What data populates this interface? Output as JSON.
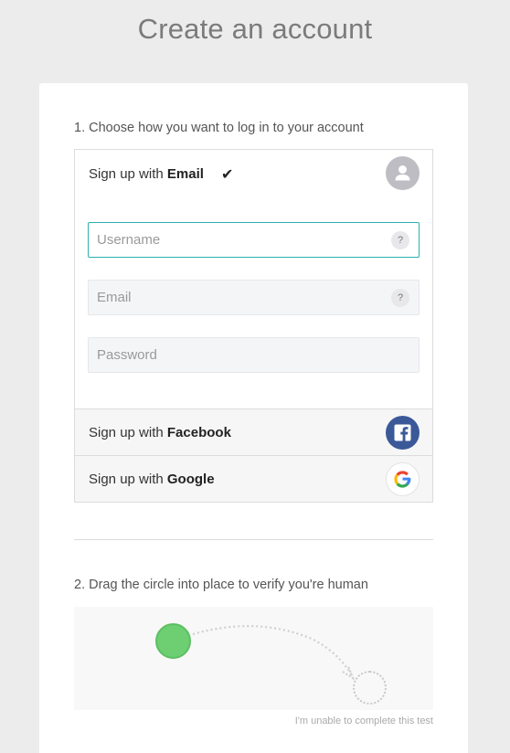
{
  "header": {
    "title": "Create an account"
  },
  "step1": {
    "label": "1. Choose how you want to log in to your account",
    "email_option": {
      "prefix": "Sign up with ",
      "method": "Email",
      "check_glyph": "✔",
      "icon": "person-icon"
    },
    "fields": {
      "username": {
        "placeholder": "Username",
        "value": "",
        "help": "?"
      },
      "email": {
        "placeholder": "Email",
        "value": "",
        "help": "?"
      },
      "password": {
        "placeholder": "Password",
        "value": ""
      }
    },
    "facebook_option": {
      "prefix": "Sign up with ",
      "method": "Facebook",
      "icon": "facebook-icon",
      "color": "#3b5998"
    },
    "google_option": {
      "prefix": "Sign up with ",
      "method": "Google",
      "icon": "google-icon"
    }
  },
  "step2": {
    "label": "2. Drag the circle into place to verify you're human",
    "drag_color": "#6dcf72",
    "unable_link": "I'm unable to complete this test"
  },
  "colors": {
    "accent": "#2bb1b0",
    "background": "#ececec"
  }
}
